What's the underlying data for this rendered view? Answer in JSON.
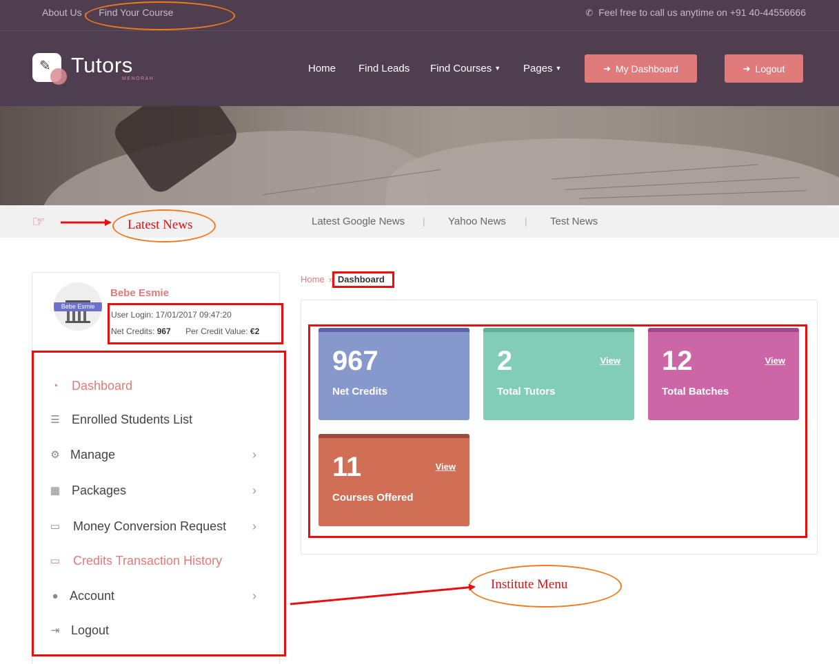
{
  "topbar": {
    "about": "About Us",
    "sep": "-",
    "find_course": "Find Your Course",
    "phone_text": "Feel free to call us anytime on +91 40-44556666"
  },
  "header": {
    "logo_name": "Tutors",
    "logo_sub": "MENORAH",
    "nav": [
      "Home",
      "Find Leads",
      "Find Courses",
      "Pages"
    ],
    "dashboard_btn": "My Dashboard",
    "logout_btn": "Logout"
  },
  "news": {
    "items": [
      "Latest Google News",
      "Yahoo News",
      "Test News"
    ],
    "divider": "|"
  },
  "annotations": {
    "latest_news": "Latest News",
    "institute_menu": "Institute Menu"
  },
  "profile": {
    "avatar_label": "Bebe Esmie",
    "name": "Bebe Esmie",
    "login_label": "User Login:",
    "login_value": "17/01/2017 09:47:20",
    "credits_label": "Net Credits:",
    "credits_value": "967",
    "per_credit_label": "Per Credit Value:",
    "per_credit_value": "€2"
  },
  "menu": [
    {
      "label": "Dashboard",
      "icon": "dashboard-icon",
      "active": true,
      "has_children": false
    },
    {
      "label": "Enrolled Students List",
      "icon": "list-icon",
      "active": false,
      "has_children": false
    },
    {
      "label": "Manage",
      "icon": "gear-icon",
      "active": false,
      "has_children": true
    },
    {
      "label": "Packages",
      "icon": "archive-icon",
      "active": false,
      "has_children": true
    },
    {
      "label": "Money Conversion Request",
      "icon": "money-icon",
      "active": false,
      "has_children": true
    },
    {
      "label": "Credits Transaction History",
      "icon": "money-icon",
      "active": true,
      "has_children": false
    },
    {
      "label": "Account",
      "icon": "user-icon",
      "active": false,
      "has_children": true
    },
    {
      "label": "Logout",
      "icon": "sign-out-icon",
      "active": false,
      "has_children": false
    }
  ],
  "breadcrumb": {
    "home": "Home",
    "sep": "»",
    "current": "Dashboard"
  },
  "cards": [
    {
      "value": "967",
      "label": "Net Credits",
      "view": "",
      "color": "#8799cc",
      "strip": "#5a64a3"
    },
    {
      "value": "2",
      "label": "Total Tutors",
      "view": "View",
      "color": "#82cdb7",
      "strip": "#5fae96"
    },
    {
      "value": "12",
      "label": "Total Batches",
      "view": "View",
      "color": "#cc66a6",
      "strip": "#a0478c"
    },
    {
      "value": "11",
      "label": "Courses Offered",
      "view": "View",
      "color": "#d06e56",
      "strip": "#9c4b3d"
    }
  ],
  "colors": {
    "header_bg": "#4f3d50",
    "accent": "#e17a7a",
    "annotation_red": "#e80f0f",
    "annotation_orange": "#f07a1e"
  }
}
